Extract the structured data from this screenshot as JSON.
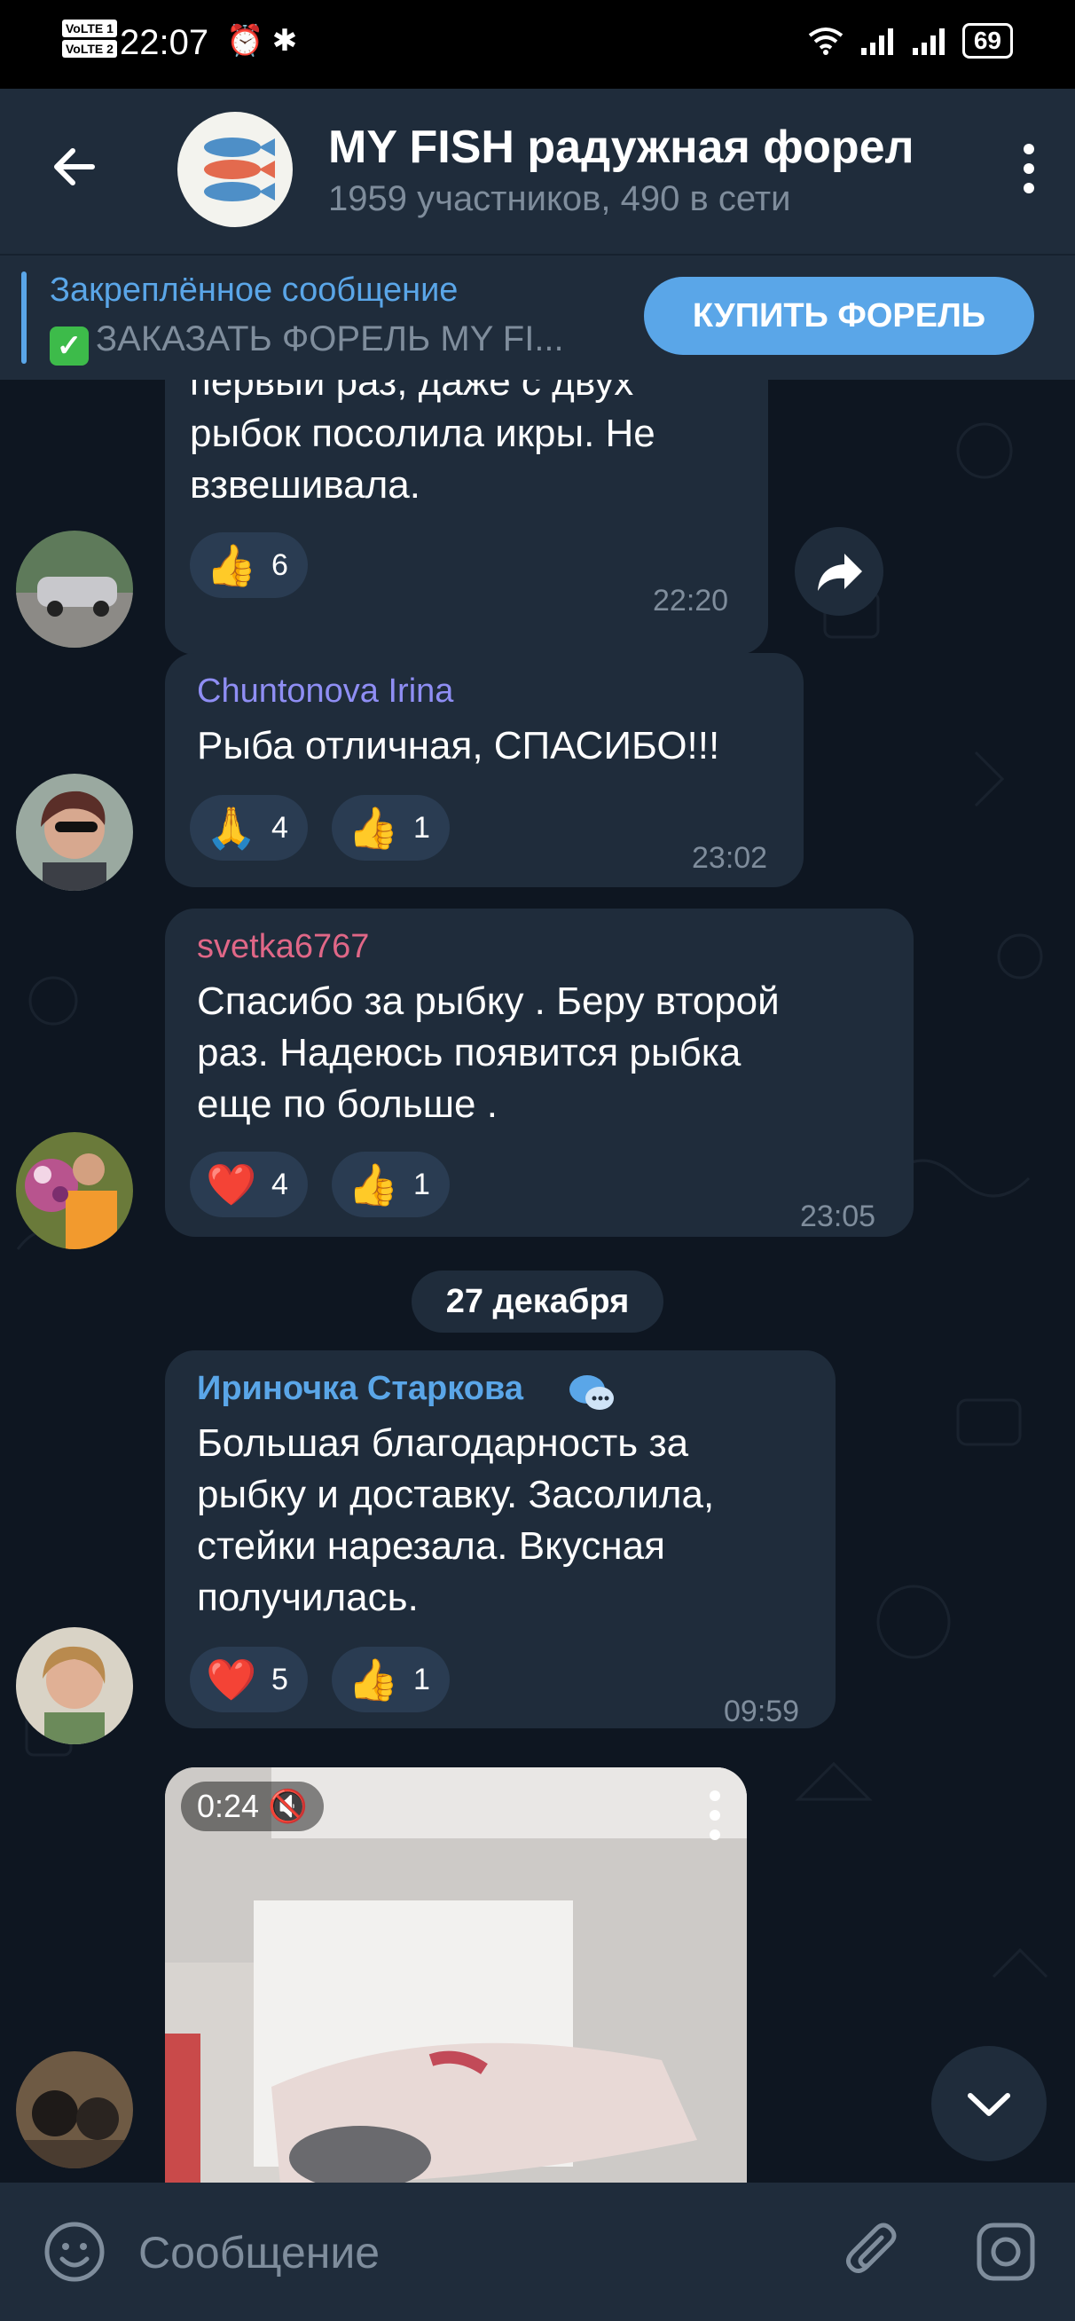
{
  "status_bar": {
    "volte1": "VoLTE 1",
    "volte2": "VoLTE 2",
    "time": "22:07",
    "battery": "69"
  },
  "header": {
    "title": "MY FISH радужная форел",
    "subtitle": "1959 участников, 490 в сети"
  },
  "pinned": {
    "title": "Закреплённое сообщение",
    "text": "ЗАКАЗАТЬ ФОРЕЛЬ MY FI...",
    "button": "КУПИТЬ ФОРЕЛЬ"
  },
  "messages": [
    {
      "sender": "",
      "text": "первый раз, даже с двух\nрыбок посолила икры. Не\nвзвешивала.",
      "reactions": [
        {
          "emoji": "👍",
          "count": "6"
        }
      ],
      "time": "22:20"
    },
    {
      "sender": "Chuntonova Irina",
      "sender_color": "#8f8ef4",
      "text": "Рыба отличная, СПАСИБО!!!",
      "reactions": [
        {
          "emoji": "🙏",
          "count": "4"
        },
        {
          "emoji": "👍",
          "count": "1"
        }
      ],
      "time": "23:02"
    },
    {
      "sender": "svetka6767",
      "sender_color": "#e06787",
      "text": "Спасибо за рыбку . Беру второй\nраз. Надеюсь появится рыбка\nеще по больше .",
      "reactions": [
        {
          "emoji": "❤️",
          "count": "4"
        },
        {
          "emoji": "👍",
          "count": "1"
        }
      ],
      "time": "23:05"
    },
    {
      "sender": "Ириночка Старкова",
      "sender_color": "#5aa6e8",
      "text": "Большая благодарность за\nрыбку и доставку. Засолила,\nстейки нарезала. Вкусная\nполучилась.",
      "reactions": [
        {
          "emoji": "❤️",
          "count": "5"
        },
        {
          "emoji": "👍",
          "count": "1"
        }
      ],
      "time": "09:59"
    }
  ],
  "date_separator": "27 декабря",
  "video": {
    "duration": "0:24"
  },
  "input": {
    "placeholder": "Сообщение"
  },
  "icons": {
    "back": "arrow-left-icon",
    "menu": "more-vertical-icon",
    "forward": "share-arrow-icon",
    "scroll": "chevron-down-icon",
    "emoji": "smiley-icon",
    "attach": "paperclip-icon",
    "camera": "instagram-camera-icon",
    "mute": "speaker-muted-icon"
  },
  "colors": {
    "background": "#0e1621",
    "bubble": "#1f2c3b",
    "accent": "#5aa6e8"
  }
}
